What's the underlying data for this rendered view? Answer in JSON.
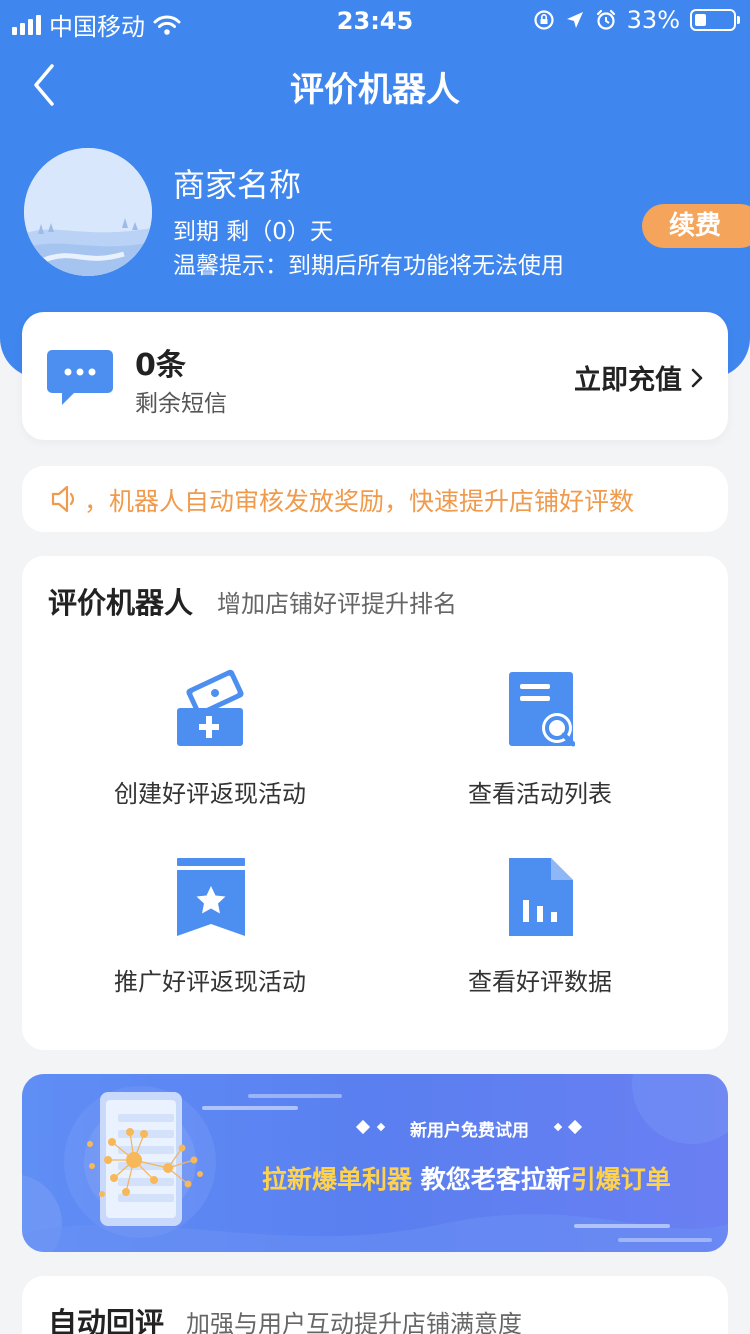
{
  "status_bar": {
    "carrier": "中国移动",
    "time": "23:45",
    "battery": "33%",
    "battery_level": 0.33
  },
  "nav": {
    "title": "评价机器人"
  },
  "merchant": {
    "name": "商家名称",
    "expire": "到期 剩（0）天",
    "tip": "温馨提示：到期后所有功能将无法使用",
    "renew_label": "续费"
  },
  "sms": {
    "count": "0条",
    "label": "剩余短信",
    "recharge_label": "立即充值"
  },
  "notice": {
    "text": "，机器人自动审核发放奖励，快速提升店铺好评数"
  },
  "robot_section": {
    "title": "评价机器人",
    "subtitle": "增加店铺好评提升排名",
    "items": [
      {
        "label": "创建好评返现活动",
        "icon": "wallet-plus-icon"
      },
      {
        "label": "查看活动列表",
        "icon": "document-search-icon"
      },
      {
        "label": "推广好评返现活动",
        "icon": "bookmark-star-icon"
      },
      {
        "label": "查看好评数据",
        "icon": "file-chart-icon"
      }
    ]
  },
  "banner": {
    "top_text": "新用户免费试用",
    "main_a": "拉新爆单利器",
    "main_b": " 教您老客拉新",
    "main_c": "引爆订单"
  },
  "auto_section": {
    "title": "自动回评",
    "subtitle": "加强与用户互动提升店铺满意度"
  },
  "colors": {
    "primary": "#3f86ee",
    "accent_orange": "#f5a45b",
    "notice_orange": "#f09a4c",
    "banner_yellow": "#ffd24d"
  }
}
